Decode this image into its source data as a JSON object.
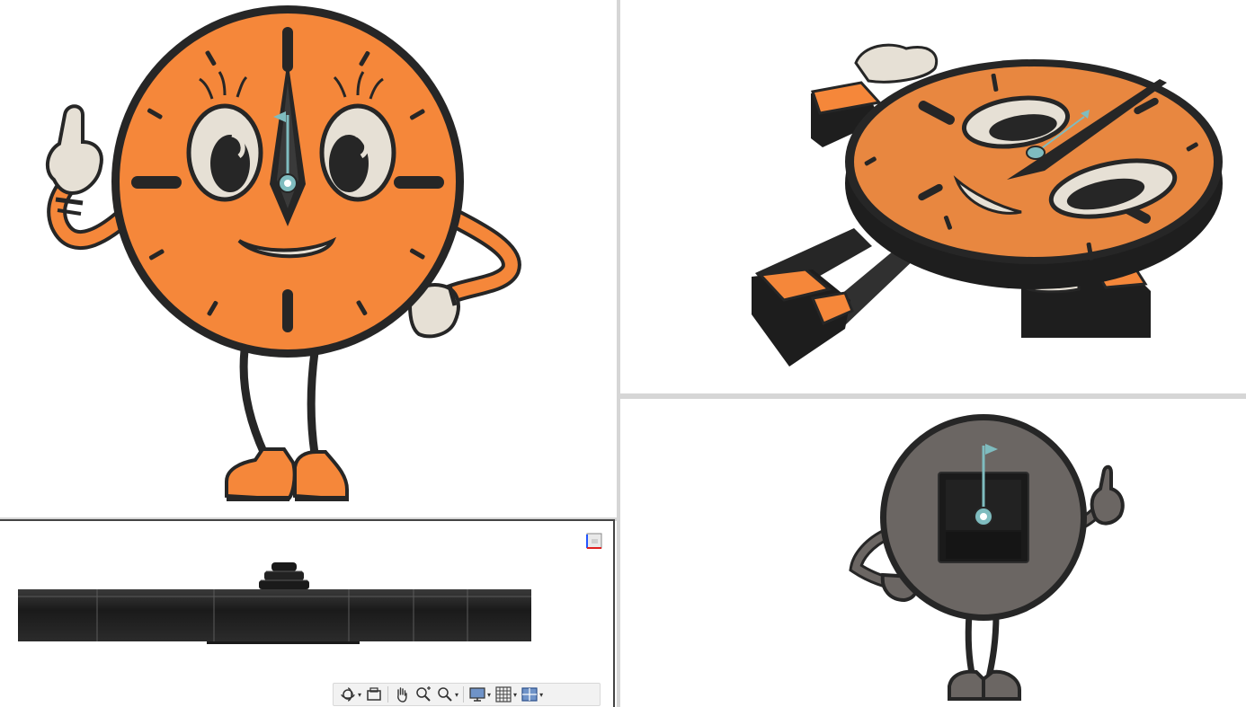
{
  "colors": {
    "body_orange": "#f5873a",
    "outline": "#262626",
    "eye_white": "#e6e0d5",
    "accent_teal": "#7fbcbf",
    "back_gray": "#6b6663",
    "pocket_black": "#1f1f1f",
    "divider": "#d6d6d6",
    "viewport_bg": "#ffffff"
  },
  "viewports": [
    {
      "id": "front",
      "view": "front"
    },
    {
      "id": "iso",
      "view": "isometric"
    },
    {
      "id": "back",
      "view": "back"
    },
    {
      "id": "side",
      "view": "bottom"
    }
  ],
  "viewcube": {
    "icon": "viewcube-icon"
  },
  "nav_toolbar": {
    "items": [
      {
        "icon": "orbit-icon",
        "dropdown": true
      },
      {
        "icon": "look-at-icon",
        "dropdown": false
      },
      {
        "icon": "pan-hand-icon",
        "dropdown": false
      },
      {
        "icon": "zoom-icon",
        "dropdown": false
      },
      {
        "icon": "zoom-window-icon",
        "dropdown": true
      },
      {
        "icon": "display-settings-icon",
        "dropdown": true
      },
      {
        "icon": "grid-settings-icon",
        "dropdown": true
      },
      {
        "icon": "viewports-icon",
        "dropdown": true
      }
    ]
  }
}
